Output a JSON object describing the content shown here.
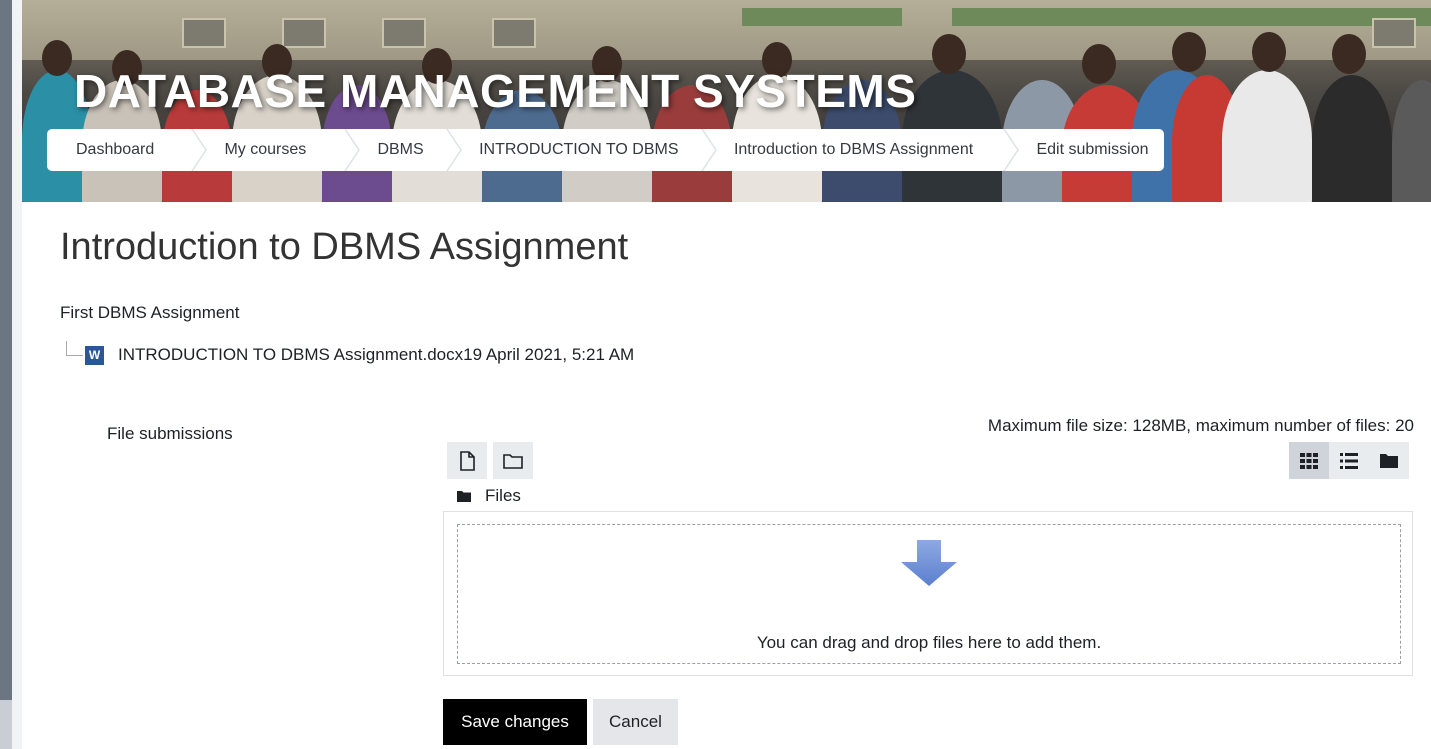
{
  "header": {
    "course_title": "DATABASE MANAGEMENT SYSTEMS"
  },
  "breadcrumb": [
    {
      "label": "Dashboard"
    },
    {
      "label": "My courses"
    },
    {
      "label": "DBMS"
    },
    {
      "label": "INTRODUCTION TO DBMS"
    },
    {
      "label": "Introduction to DBMS Assignment"
    },
    {
      "label": "Edit submission"
    }
  ],
  "main": {
    "page_title": "Introduction to DBMS Assignment",
    "intro": "First DBMS Assignment",
    "attachment": {
      "icon": "word-document-icon",
      "file_name": "INTRODUCTION TO DBMS Assignment.docx",
      "date": "19 April 2021, 5:21 AM"
    }
  },
  "file_submissions": {
    "label": "File submissions",
    "limits": "Maximum file size: 128MB, maximum number of files: 20",
    "toolbar": {
      "add_file_icon": "file-icon",
      "create_folder_icon": "folder-icon"
    },
    "view_modes": [
      "grid-view-icon",
      "list-view-icon",
      "folder-tree-icon"
    ],
    "active_view": "grid",
    "path_label": "Files",
    "dropzone_text": "You can drag and drop files here to add them."
  },
  "actions": {
    "save_label": "Save changes",
    "cancel_label": "Cancel"
  },
  "colors": {
    "primary_button": "#000000",
    "secondary_button": "#e4e6e9",
    "dropzone_arrow": "#6d8fd6"
  }
}
